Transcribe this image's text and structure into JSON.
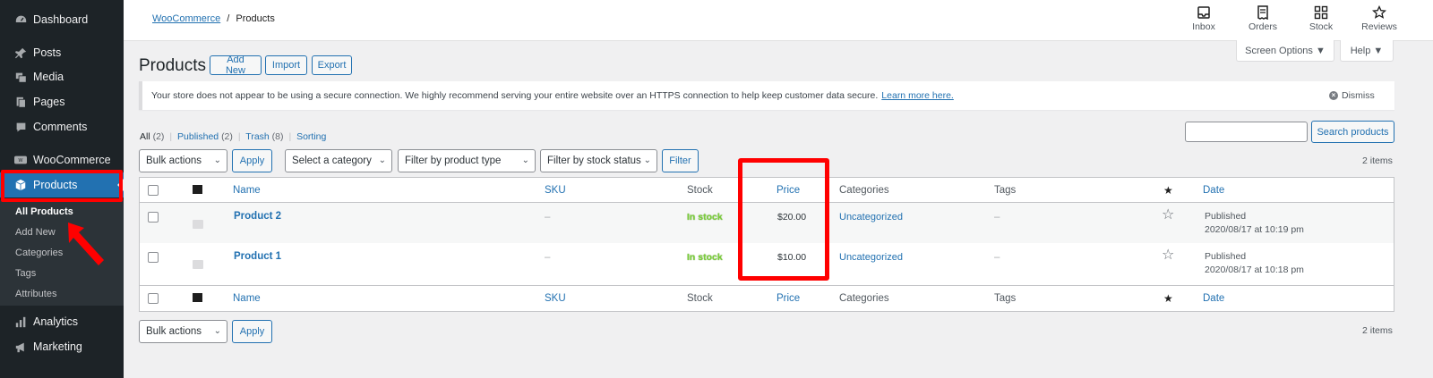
{
  "sidebar": {
    "items": [
      {
        "label": "Dashboard",
        "icon": "dashboard-icon"
      },
      {
        "label": "Posts",
        "icon": "pin-icon"
      },
      {
        "label": "Media",
        "icon": "media-icon"
      },
      {
        "label": "Pages",
        "icon": "pages-icon"
      },
      {
        "label": "Comments",
        "icon": "comment-icon"
      },
      {
        "label": "WooCommerce",
        "icon": "woo-icon"
      },
      {
        "label": "Products",
        "icon": "box-icon"
      },
      {
        "label": "Analytics",
        "icon": "bar-chart-icon"
      },
      {
        "label": "Marketing",
        "icon": "megaphone-icon"
      }
    ],
    "submenu": [
      "All Products",
      "Add New",
      "Categories",
      "Tags",
      "Attributes"
    ]
  },
  "topbar": {
    "breadcrumb_link": "WooCommerce",
    "breadcrumb_sep": "/",
    "breadcrumb_current": "Products",
    "buttons": [
      {
        "label": "Inbox",
        "icon": "inbox-icon"
      },
      {
        "label": "Orders",
        "icon": "orders-icon"
      },
      {
        "label": "Stock",
        "icon": "stock-icon"
      },
      {
        "label": "Reviews",
        "icon": "star-icon"
      }
    ],
    "screen_options": "Screen Options ▼",
    "help": "Help ▼"
  },
  "page": {
    "title": "Products",
    "add_new": "Add New",
    "import": "Import",
    "export": "Export"
  },
  "notice": {
    "text": "Your store does not appear to be using a secure connection. We highly recommend serving your entire website over an HTTPS connection to help keep customer data secure.",
    "link": "Learn more here.",
    "dismiss": "Dismiss"
  },
  "views": {
    "all": "All",
    "all_count": "(2)",
    "published": "Published",
    "published_count": "(2)",
    "trash": "Trash",
    "trash_count": "(8)",
    "sorting": "Sorting",
    "sep": "|"
  },
  "search": {
    "button": "Search products",
    "value": ""
  },
  "filters": {
    "bulk_actions": "Bulk actions",
    "apply": "Apply",
    "category": "Select a category",
    "product_type": "Filter by product type",
    "stock_status": "Filter by stock status",
    "filter": "Filter",
    "items_count": "2 items"
  },
  "table": {
    "columns": {
      "name": "Name",
      "sku": "SKU",
      "stock": "Stock",
      "price": "Price",
      "categories": "Categories",
      "tags": "Tags",
      "date": "Date"
    },
    "rows": [
      {
        "name": "Product 2",
        "sku": "–",
        "stock": "In stock",
        "price": "$20.00",
        "category": "Uncategorized",
        "tags": "–",
        "status": "Published",
        "date": "2020/08/17 at 10:19 pm"
      },
      {
        "name": "Product 1",
        "sku": "–",
        "stock": "In stock",
        "price": "$10.00",
        "category": "Uncategorized",
        "tags": "–",
        "status": "Published",
        "date": "2020/08/17 at 10:18 pm"
      }
    ]
  },
  "bottom": {
    "bulk_actions": "Bulk actions",
    "apply": "Apply",
    "items_count": "2 items"
  },
  "colors": {
    "sidebar_bg": "#1d2327",
    "accent": "#2271b1",
    "in_stock": "#7ad03a",
    "highlight": "#ff0000"
  }
}
